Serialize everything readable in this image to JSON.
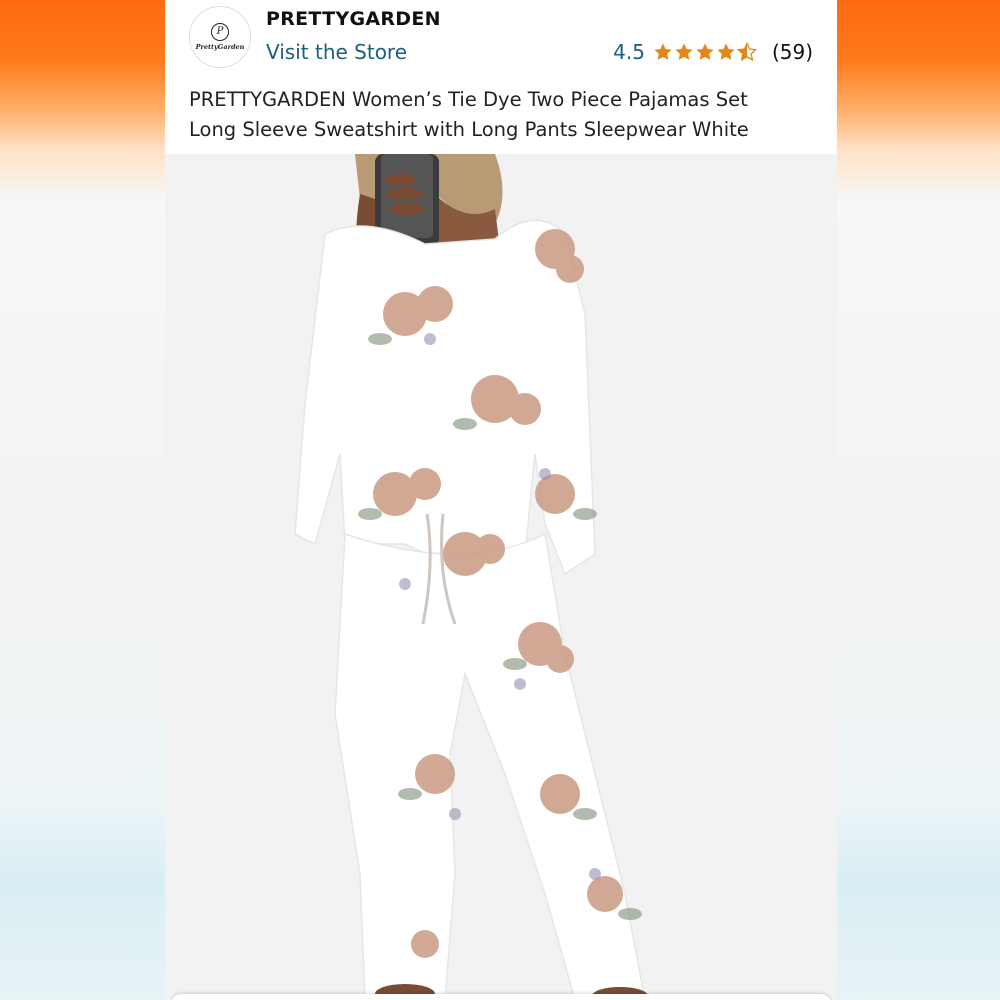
{
  "store": {
    "logo_text": "PrettyGarden",
    "brand_name": "PRETTYGARDEN",
    "visit_link": "Visit the Store"
  },
  "rating": {
    "value": "4.5",
    "stars": 4.5,
    "review_count": "(59)",
    "star_color": "#e3861b"
  },
  "product": {
    "title_line1": "PRETTYGARDEN Women’s Tie Dye Two Piece Pajamas Set",
    "title_line2": "Long Sleeve Sweatshirt with Long Pants Sleepwear White"
  },
  "colors": {
    "link": "#1d5f7e",
    "accent_orange": "#ff6a10"
  }
}
